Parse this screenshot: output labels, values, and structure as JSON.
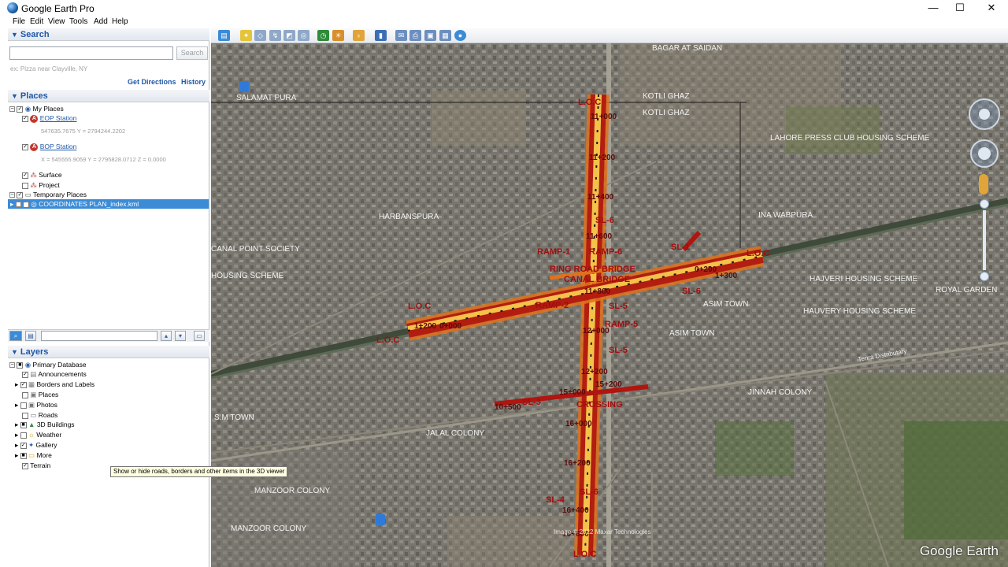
{
  "window": {
    "title": "Google Earth Pro",
    "minimize": "—",
    "maximize": "☐",
    "close": "✕"
  },
  "menu": [
    "File",
    "Edit",
    "View",
    "Tools",
    "Add",
    "Help"
  ],
  "search": {
    "header": "Search",
    "placeholder": "",
    "button": "Search",
    "hint": "ex: Pizza near Clayville, NY",
    "get_directions": "Get Directions",
    "history": "History"
  },
  "places": {
    "header": "Places",
    "items": [
      {
        "label": "My Places"
      },
      {
        "label": "EOP Station",
        "coord": "547635.7675 Y = 2794244.2202"
      },
      {
        "label": "BOP Station",
        "coord": "X = 545555.9059 Y = 2795828.0712 Z = 0.0000"
      },
      {
        "label": "Surface"
      },
      {
        "label": "Project"
      },
      {
        "label": "Temporary Places"
      },
      {
        "label": "COORDINATES PLAN_index.kml"
      }
    ]
  },
  "layers": {
    "header": "Layers",
    "items": [
      {
        "label": "Primary Database"
      },
      {
        "label": "Announcements"
      },
      {
        "label": "Borders and Labels"
      },
      {
        "label": "Places"
      },
      {
        "label": "Photos"
      },
      {
        "label": "Roads"
      },
      {
        "label": "3D Buildings"
      },
      {
        "label": "Weather"
      },
      {
        "label": "Gallery"
      },
      {
        "label": "More"
      },
      {
        "label": "Terrain"
      }
    ],
    "tooltip": "Show or hide roads, borders and other items in the 3D viewer"
  },
  "map": {
    "place_labels": [
      "BAGAR AT SAIDAN",
      "SALAMAT PURA",
      "KOTLI GHAZ",
      "KOTLI GHAZ",
      "LAHORE PRESS CLUB HOUSING SCHEME",
      "HARBANSPURA",
      "CANAL POINT SOCIETY",
      "HOUSING SCHEME",
      "INA WABPURA",
      "HAJVERI HOUSING SCHEME",
      "ROYAL GARDEN",
      "HAUVERY HOUSING SCHEME",
      "ASIM TOWN",
      "ASIM TOWN",
      "JINNAH COLONY",
      "S.M TOWN",
      "JALAL COLONY",
      "MANZOOR COLONY",
      "MANZOOR COLONY",
      "Tenra Distributary"
    ],
    "kml_labels": [
      "L.O.C",
      "L.O.C",
      "L.O.C",
      "L.O.C",
      "L.O.C",
      "RAMP-1",
      "RAMP-6",
      "RAMP-5",
      "RAMP-2",
      "SL-6",
      "SL-5",
      "SL-5",
      "SL-6",
      "SL-3",
      "SL-4",
      "SL-6",
      "SL-1",
      "RING ROAD BRIDGE",
      "CANAL BRIDGE",
      "CROSSING"
    ],
    "chainages": [
      "11+000",
      "11+200",
      "11+400",
      "11+600",
      "11+800",
      "12+000",
      "12+200",
      "15+000",
      "15+200",
      "16+000",
      "16+200",
      "16+400",
      "16+600",
      "1+200",
      "1+300",
      "0+000",
      "0+200",
      "10+500"
    ],
    "copyright": "Image © 2022 Maxar Technologies",
    "logo": "Google Earth"
  }
}
